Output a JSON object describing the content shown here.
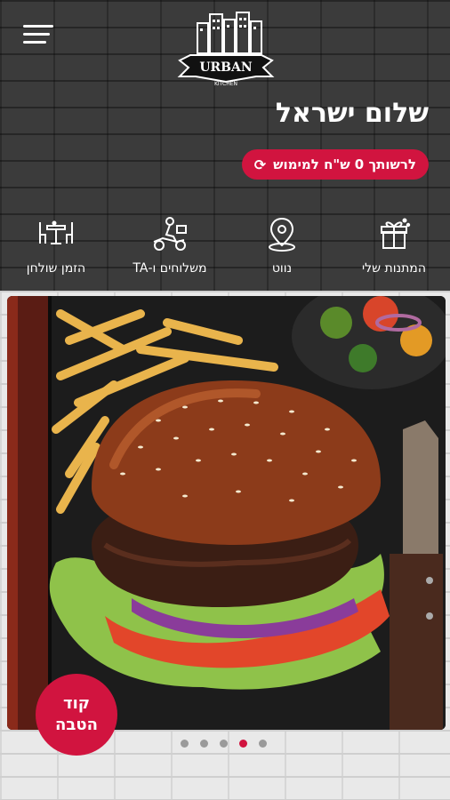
{
  "header": {
    "menu_icon": "hamburger-menu-icon",
    "logo_text": "URBAN",
    "logo_subtext": "KITCHEN"
  },
  "greeting": "שלום ישראל",
  "balance_label": "לרשותך 0 ש\"ח למימוש",
  "balance_icon": "refresh-icon",
  "quick_actions": [
    {
      "label": "המתנות שלי",
      "icon": "gift-icon"
    },
    {
      "label": "נווט",
      "icon": "location-pin-icon"
    },
    {
      "label": "משלוחים ו-TA",
      "icon": "delivery-scooter-icon"
    },
    {
      "label": "הזמן שולחן",
      "icon": "table-chairs-icon"
    }
  ],
  "coupon_button": {
    "line1": "קוד",
    "line2": "הטבה"
  },
  "carousel": {
    "image": "burger-photo",
    "slides": 5,
    "active_slide": 4
  },
  "colors": {
    "accent": "#d1143f",
    "dark_bg": "#3b3b3b"
  }
}
